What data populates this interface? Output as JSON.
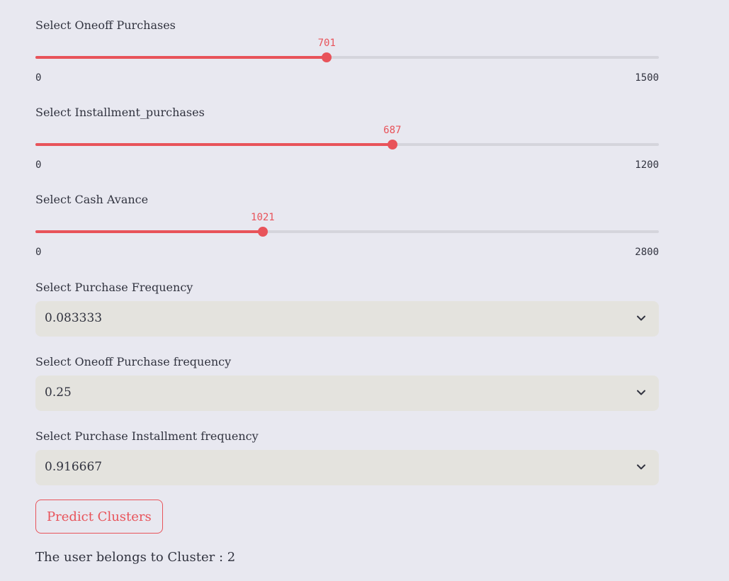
{
  "theme": {
    "accent": "#e8535a",
    "background": "#e8e8f0",
    "track": "#d5d5dc",
    "select_bg": "#e4e3de",
    "text": "#31333f"
  },
  "sliders": [
    {
      "label": "Select Oneoff Purchases",
      "value": 701,
      "min": 0,
      "max": 1500,
      "value_text": "701",
      "min_text": "0",
      "max_text": "1500"
    },
    {
      "label": "Select Installment_purchases",
      "value": 687,
      "min": 0,
      "max": 1200,
      "value_text": "687",
      "min_text": "0",
      "max_text": "1200"
    },
    {
      "label": "Select Cash Avance",
      "value": 1021,
      "min": 0,
      "max": 2800,
      "value_text": "1021",
      "min_text": "0",
      "max_text": "2800"
    }
  ],
  "selects": [
    {
      "label": "Select Purchase Frequency",
      "value": "0.083333",
      "icon": "chevron-down-icon"
    },
    {
      "label": "Select Oneoff Purchase frequency",
      "value": "0.25",
      "icon": "chevron-down-icon"
    },
    {
      "label": "Select Purchase Installment frequency",
      "value": "0.916667",
      "icon": "chevron-down-icon"
    }
  ],
  "predict_button": {
    "label": "Predict Clusters"
  },
  "result": {
    "text": "The user belongs to Cluster : 2"
  }
}
